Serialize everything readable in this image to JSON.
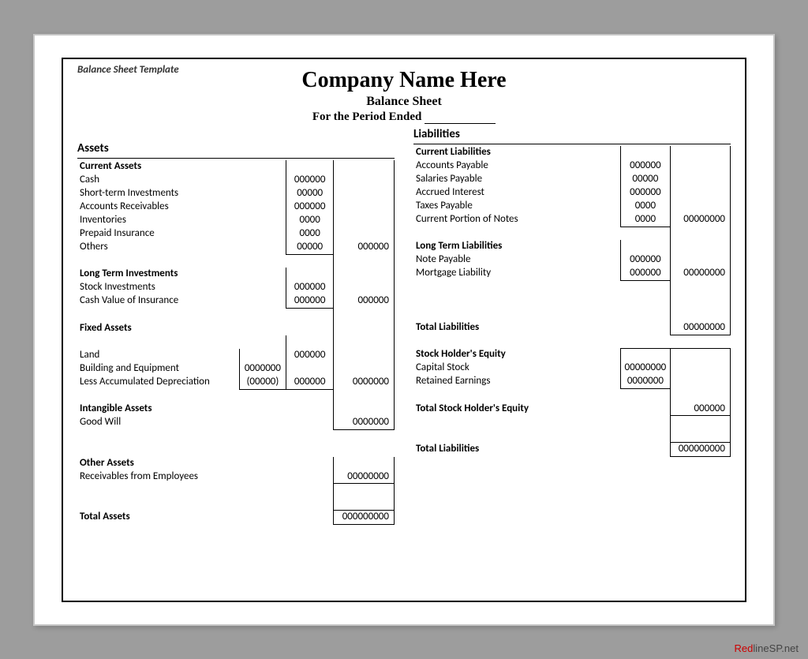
{
  "template_label": "Balance Sheet Template",
  "company": "Company Name Here",
  "subtitle": "Balance Sheet",
  "period_label": "For the Period Ended",
  "footer": {
    "red": "Red",
    "rest": "lineSP.net"
  },
  "assets": {
    "title": "Assets",
    "current_assets": {
      "title": "Current Assets"
    },
    "cash": {
      "label": "Cash",
      "val": "000000"
    },
    "sti": {
      "label": "Short-term Investments",
      "val": "00000"
    },
    "ar": {
      "label": "Accounts Receivables",
      "val": "000000"
    },
    "inv": {
      "label": "Inventories",
      "val": "0000"
    },
    "prepaid": {
      "label": "Prepaid Insurance",
      "val": "0000"
    },
    "others": {
      "label": "Others",
      "val": "00000",
      "total": "000000"
    },
    "lti": {
      "title": "Long Term Investments"
    },
    "stock_inv": {
      "label": "Stock Investments",
      "val": "000000"
    },
    "cash_ins": {
      "label": "Cash Value of Insurance",
      "val": "000000",
      "total": "000000"
    },
    "fixed": {
      "title": "Fixed Assets"
    },
    "land": {
      "label": "Land",
      "val": "000000"
    },
    "building": {
      "label": "Building and Equipment",
      "val": "0000000"
    },
    "less_dep": {
      "label": "Less Accumulated Depreciation",
      "val": "(00000)",
      "sub": "000000",
      "total": "0000000"
    },
    "intangible": {
      "title": "Intangible Assets"
    },
    "goodwill": {
      "label": "Good Will",
      "total": "0000000"
    },
    "other": {
      "title": "Other Assets"
    },
    "recv_emp": {
      "label": "Receivables from Employees",
      "total": "00000000"
    },
    "total_assets": {
      "label": "Total Assets",
      "total": "000000000"
    }
  },
  "liab": {
    "title": "Liabilities",
    "current": {
      "title": "Current Liabilities"
    },
    "ap": {
      "label": "Accounts Payable",
      "val": "000000"
    },
    "sal": {
      "label": "Salaries Payable",
      "val": "00000"
    },
    "accr": {
      "label": "Accrued Interest",
      "val": "000000"
    },
    "taxes": {
      "label": "Taxes Payable",
      "val": "0000"
    },
    "cpn": {
      "label": "Current Portion of Notes",
      "val": "0000",
      "total": "00000000"
    },
    "lt": {
      "title": "Long Term Liabilities"
    },
    "note": {
      "label": "Note Payable",
      "val": "000000"
    },
    "mort": {
      "label": "Mortgage Liability",
      "val": "000000",
      "total": "00000000"
    },
    "total_liab": {
      "label": "Total Liabilities",
      "total": "00000000"
    },
    "she": {
      "title": "Stock Holder's Equity"
    },
    "capstock": {
      "label": "Capital Stock",
      "val": "00000000"
    },
    "retained": {
      "label": "Retained Earnings",
      "val": "0000000"
    },
    "total_she": {
      "label": "Total Stock Holder's Equity",
      "total": "000000"
    },
    "total_liab2": {
      "label": "Total Liabilities",
      "total": "000000000"
    }
  }
}
